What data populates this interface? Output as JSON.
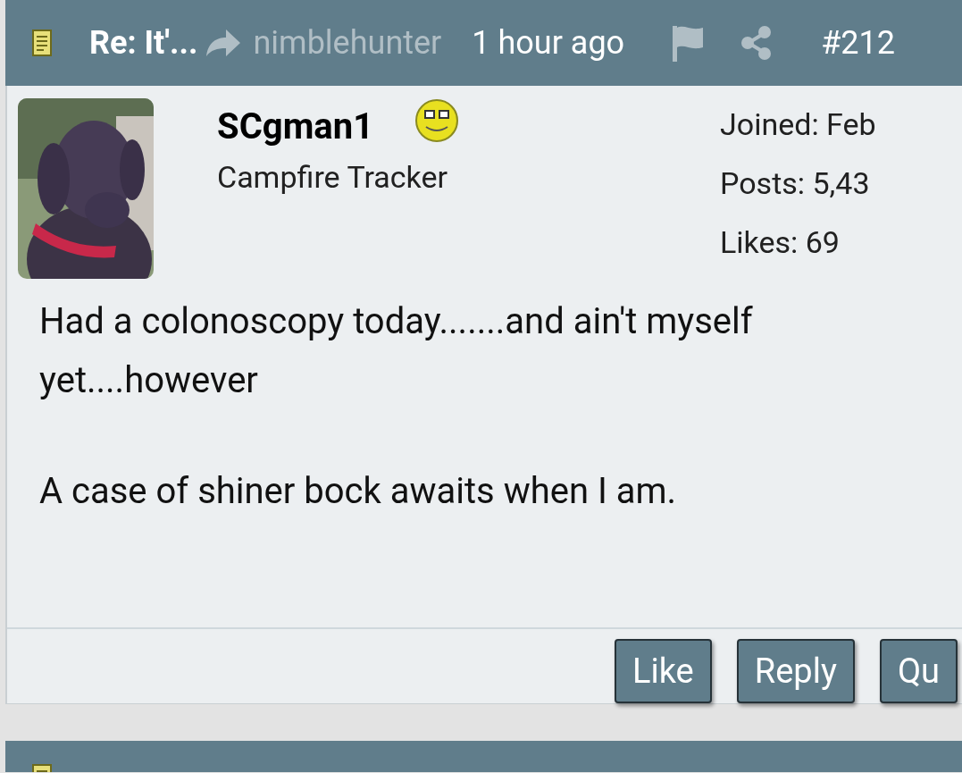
{
  "post": {
    "title": "Re: It'...",
    "author": "nimblehunter",
    "time": "1 hour ago",
    "number": "#212",
    "user": {
      "name": "SCgman1",
      "rank": "Campfire Tracker",
      "stats": [
        "Joined: Feb",
        "Posts: 5,43",
        "Likes: 69"
      ]
    },
    "body": [
      "Had a colonoscopy today.......and ain't myself yet....however",
      "A case of shiner bock awaits when I am."
    ],
    "buttons": [
      "Like",
      "Reply",
      "Qu"
    ]
  }
}
